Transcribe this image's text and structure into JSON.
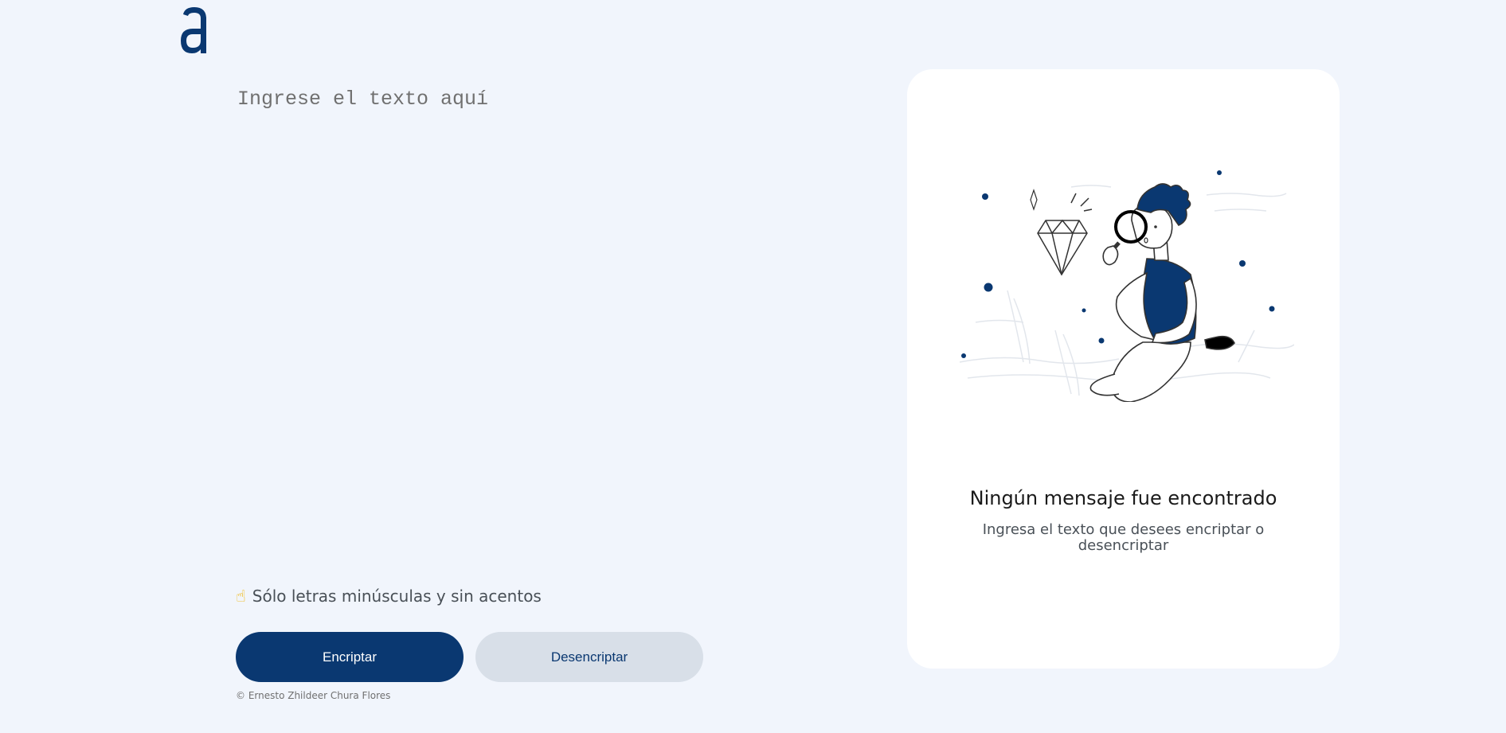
{
  "logo": {
    "icon": "alura-logo-icon",
    "color": "#0a3871"
  },
  "input": {
    "placeholder": "Ingrese el texto aquí",
    "value": ""
  },
  "hint": {
    "icon": "pointing-finger-icon",
    "text": "Sólo letras minúsculas y sin acentos"
  },
  "buttons": {
    "encrypt_label": "Encriptar",
    "decrypt_label": "Desencriptar"
  },
  "footer": {
    "text": "© Ernesto Zhildeer Chura Flores"
  },
  "output_card": {
    "illustration": "person-with-magnifying-glass-illustration",
    "title": "Ningún mensaje fue encontrado",
    "subtitle": "Ingresa el texto que desees encriptar o desencriptar"
  },
  "colors": {
    "background": "#f1f5fc",
    "primary": "#0a3871",
    "secondary_button": "#d8dfe8",
    "card": "#ffffff"
  }
}
